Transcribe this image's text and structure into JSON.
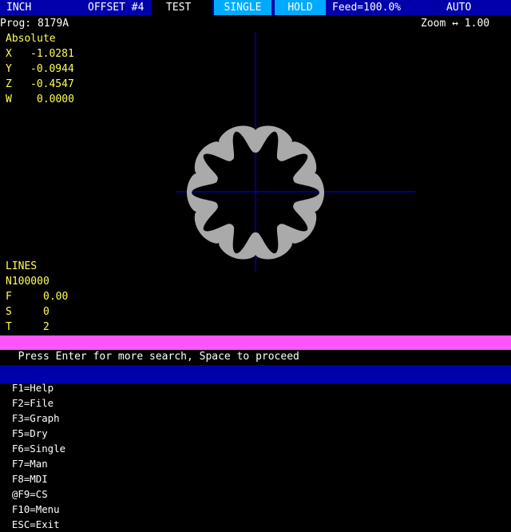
{
  "status_bar": {
    "units": "INCH",
    "offset": "OFFSET #4",
    "mode_label": "TEST",
    "single_label": "SINGLE",
    "hold_label": "HOLD",
    "feed": "Feed=100.0%",
    "auto_label": "AUTO"
  },
  "program": {
    "label": "Prog: 8179A"
  },
  "zoom": {
    "label": "Zoom ↔ 1.00"
  },
  "position": {
    "title": "Absolute",
    "axes": [
      {
        "axis": "X",
        "value": "-1.0281"
      },
      {
        "axis": "Y",
        "value": "-0.0944"
      },
      {
        "axis": "Z",
        "value": "-0.4547"
      },
      {
        "axis": "W",
        "value": "0.0000"
      }
    ]
  },
  "lines": {
    "title": "LINES",
    "line_number": "N100000",
    "params": [
      {
        "name": "F",
        "value": "0.00"
      },
      {
        "name": "S",
        "value": "0"
      },
      {
        "name": "T",
        "value": "2"
      }
    ]
  },
  "message": "Press Enter for more search, Space to proceed",
  "function_keys": [
    "F1=Help",
    "F2=File",
    "F3=Graph",
    "F5=Dry",
    "F6=Single",
    "F7=Man",
    "F8=MDI",
    "@F9=CS",
    "F10=Menu",
    "ESC=Exit"
  ],
  "colors": {
    "background": "#000000",
    "status_blue": "#0000aa",
    "highlight_cyan": "#00aaff",
    "label_yellow": "#ffff55",
    "message_magenta": "#ff55ff",
    "crosshair_blue": "#0000ff",
    "toolpath_gray": "#aaaaaa"
  },
  "graphic": {
    "shape": "gear-toolpath",
    "lobes": 10
  }
}
